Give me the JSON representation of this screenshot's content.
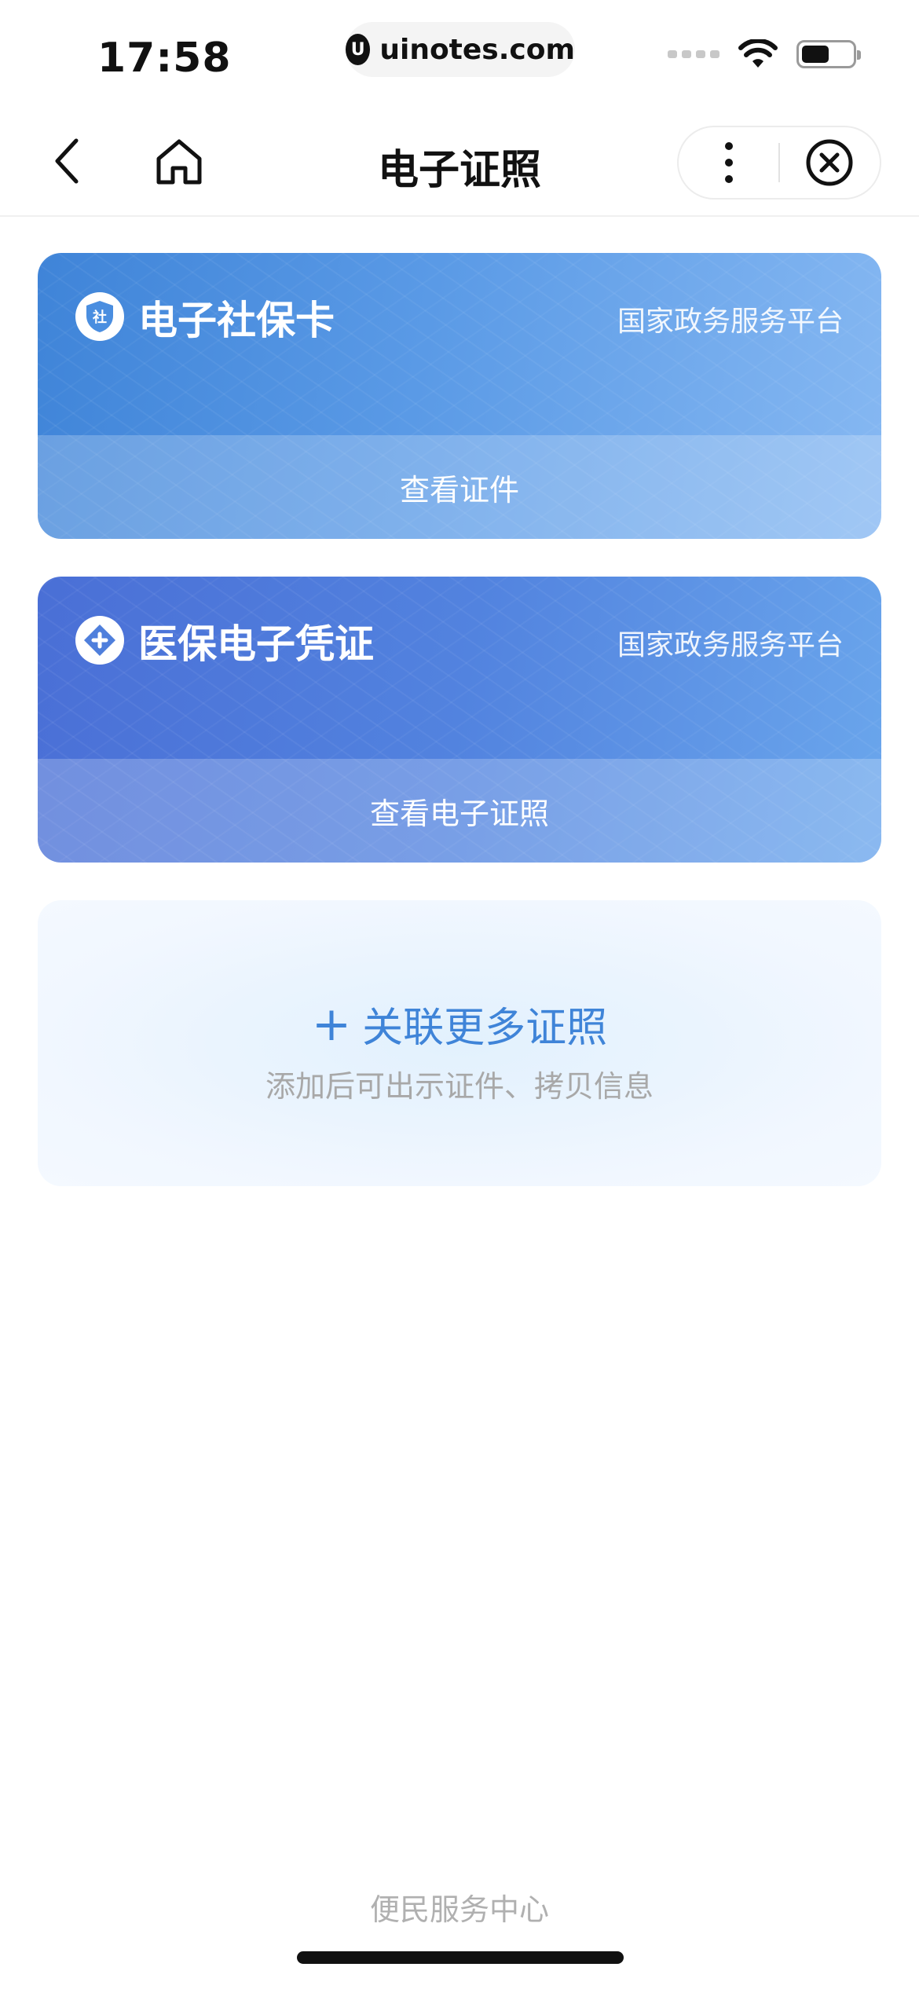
{
  "status_bar": {
    "time": "17:58",
    "url": "uinotes.com",
    "url_logo": "U"
  },
  "nav": {
    "title": "电子证照",
    "icons": {
      "back": "chevron-left-icon",
      "home": "home-icon",
      "more": "more-vertical-icon",
      "close": "close-circle-icon"
    }
  },
  "cards": [
    {
      "title": "电子社保卡",
      "issuer": "国家政务服务平台",
      "action": "查看证件",
      "icon": "social-security-icon",
      "icon_glyph": "社",
      "color": "#3f84d8"
    },
    {
      "title": "医保电子凭证",
      "issuer": "国家政务服务平台",
      "action": "查看电子证照",
      "icon": "medical-insurance-icon",
      "color": "#4a6fd6"
    }
  ],
  "add_more": {
    "plus": "+",
    "title": "关联更多证照",
    "subtitle": "添加后可出示证件、拷贝信息",
    "color": "#3f84d8"
  },
  "footer": {
    "link": "便民服务中心"
  }
}
